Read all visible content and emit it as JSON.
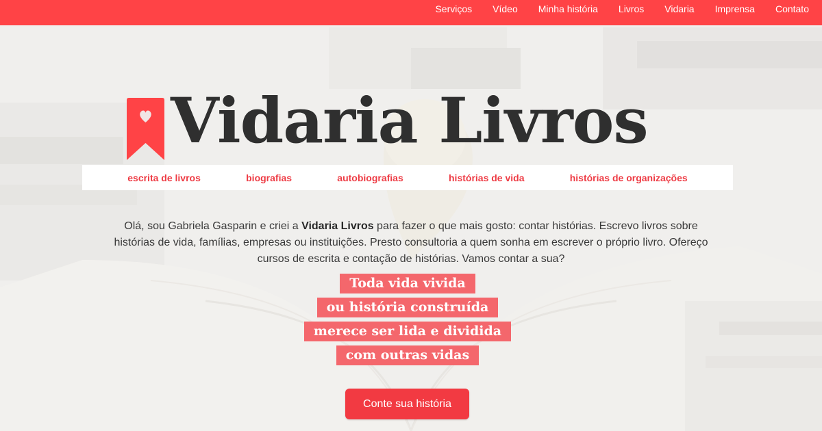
{
  "nav": {
    "items": [
      {
        "label": "Serviços"
      },
      {
        "label": "Vídeo"
      },
      {
        "label": "Minha história"
      },
      {
        "label": "Livros"
      },
      {
        "label": "Vidaria"
      },
      {
        "label": "Imprensa"
      },
      {
        "label": "Contato"
      }
    ]
  },
  "brand": {
    "title": "Vidaria Livros",
    "icon": "bookmark-heart-icon"
  },
  "categories": [
    {
      "label": "escrita de livros"
    },
    {
      "label": "biografias"
    },
    {
      "label": "autobiografias"
    },
    {
      "label": "histórias de vida"
    },
    {
      "label": "histórias de organizações"
    }
  ],
  "intro": {
    "before": "Olá, sou Gabriela Gasparin e criei a ",
    "brand_name": "Vidaria Livros",
    "after": " para fazer o que mais gosto: contar histórias. Escrevo livros sobre histórias de vida, famílias, empresas ou instituições. Presto consultoria a quem sonha em escrever o próprio livro. Ofereço cursos de escrita e contação de histórias. Vamos contar a sua?"
  },
  "quote": {
    "lines": [
      "Toda vida vivida",
      "ou história construída",
      "merece ser lida e dividida",
      "com outras vidas"
    ]
  },
  "cta": {
    "label": "Conte sua história"
  },
  "colors": {
    "accent": "#ff4346",
    "quote_bg": "#f4676c",
    "title": "#2f2f2f"
  }
}
